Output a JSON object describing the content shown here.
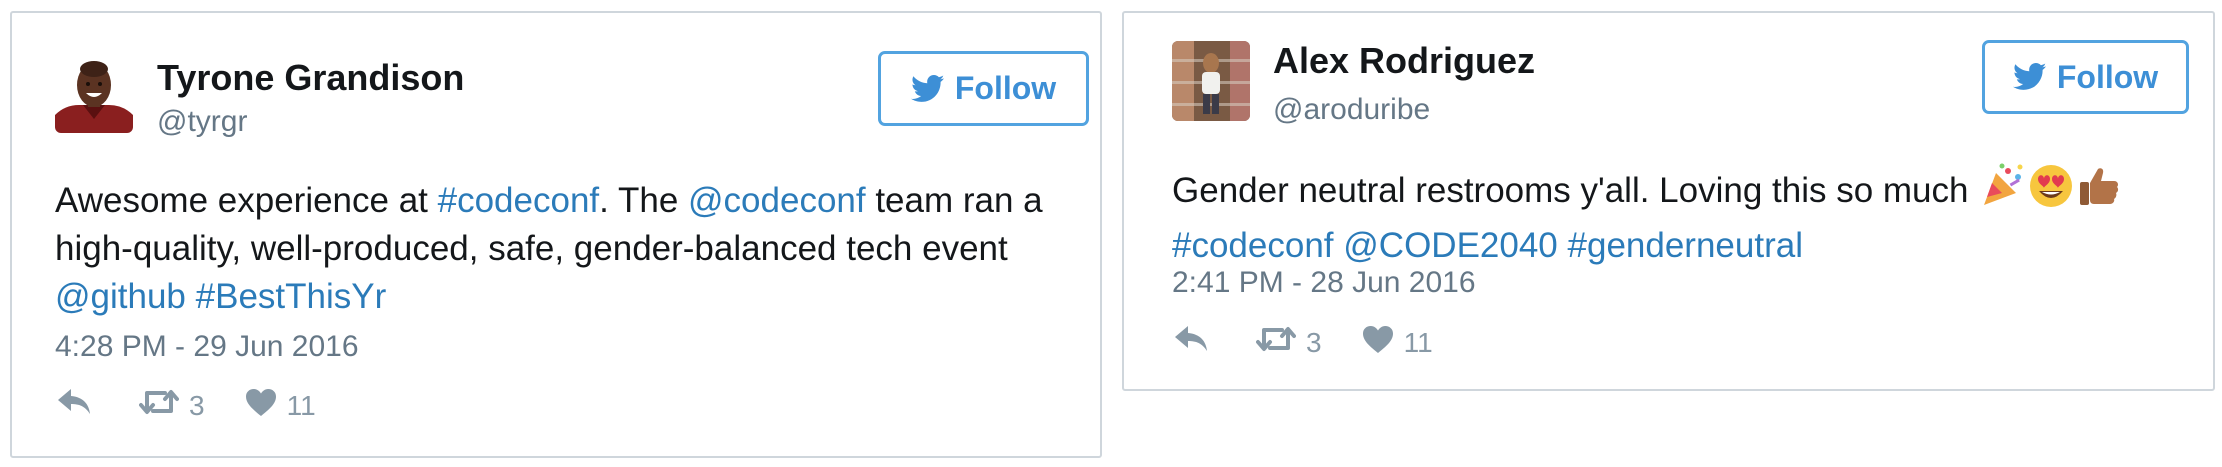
{
  "colors": {
    "link": "#2b7bb9",
    "follow_border": "#52a3e0",
    "muted": "#657786",
    "action_icon": "#8899a6"
  },
  "tweets": [
    {
      "author_name": "Tyrone Grandison",
      "author_handle": "@tyrgr",
      "follow_label": "Follow",
      "text": {
        "l1_a": "Awesome experience at ",
        "l1_b": "#codeconf",
        "l1_c": ". The ",
        "l1_d": "@codeconf",
        "l1_e": " team ran a",
        "l2": "high-quality, well-produced, safe, gender-balanced tech event",
        "l3_a": "@github",
        "l3_b": "#BestThisYr"
      },
      "timestamp": "4:28 PM - 29 Jun 2016",
      "retweet_count": "3",
      "like_count": "11",
      "icons": [
        "reply-icon",
        "retweet-icon",
        "heart-icon",
        "twitter-bird-icon"
      ]
    },
    {
      "author_name": "Alex Rodriguez",
      "author_handle": "@aroduribe",
      "follow_label": "Follow",
      "text": {
        "l1": "Gender neutral restrooms y'all. Loving this so much",
        "l2_a": "#codeconf",
        "l2_b": "@CODE2040",
        "l2_c": "#genderneutral"
      },
      "emojis": [
        "party-popper-emoji",
        "heart-eyes-emoji",
        "thumbs-up-emoji"
      ],
      "timestamp": "2:41 PM - 28 Jun 2016",
      "retweet_count": "3",
      "like_count": "11",
      "icons": [
        "reply-icon",
        "retweet-icon",
        "heart-icon",
        "twitter-bird-icon"
      ]
    }
  ]
}
